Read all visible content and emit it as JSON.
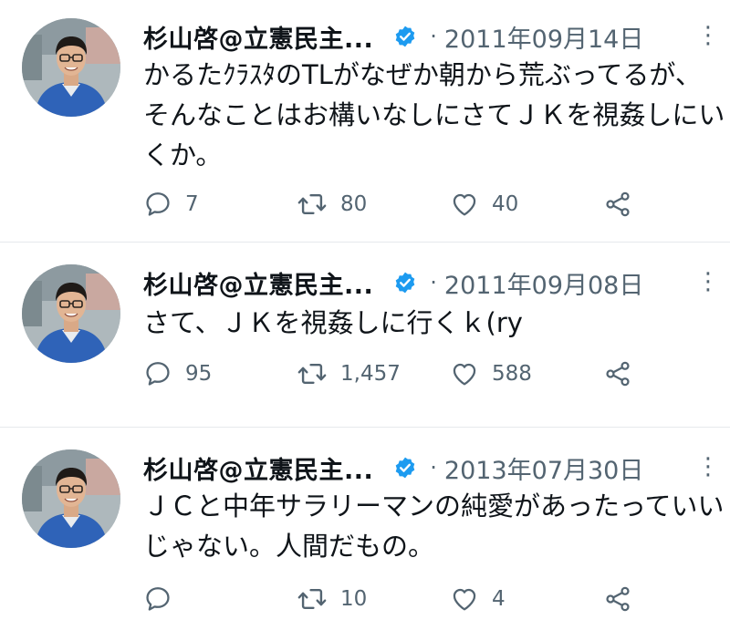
{
  "tweets": [
    {
      "name": "杉山啓@立憲民主...",
      "date": "2011年09月14日",
      "text": "かるたｸﾗｽﾀのTLがなぜか朝から荒ぶってるが、そんなことはお構いなしにさてＪＫを視姦しにいくか。",
      "replies": "7",
      "retweets": "80",
      "likes": "40"
    },
    {
      "name": "杉山啓@立憲民主...",
      "date": "2011年09月08日",
      "text": "さて、ＪＫを視姦しに行くｋ(ry",
      "replies": "95",
      "retweets": "1,457",
      "likes": "588"
    },
    {
      "name": "杉山啓@立憲民主...",
      "date": "2013年07月30日",
      "text": "ＪＣと中年サラリーマンの純愛があったっていいじゃない。人間だもの。",
      "replies": "",
      "retweets": "10",
      "likes": "4"
    }
  ],
  "separator": "·",
  "more_glyph": "⋮",
  "icons": {
    "reply": "reply-icon",
    "retweet": "retweet-icon",
    "like": "heart-icon",
    "share": "share-icon",
    "verified": "verified-badge-icon"
  },
  "colors": {
    "text": "#0f1419",
    "secondary": "#536471",
    "verified": "#1d9bf0",
    "divider": "#e6e9ec"
  }
}
